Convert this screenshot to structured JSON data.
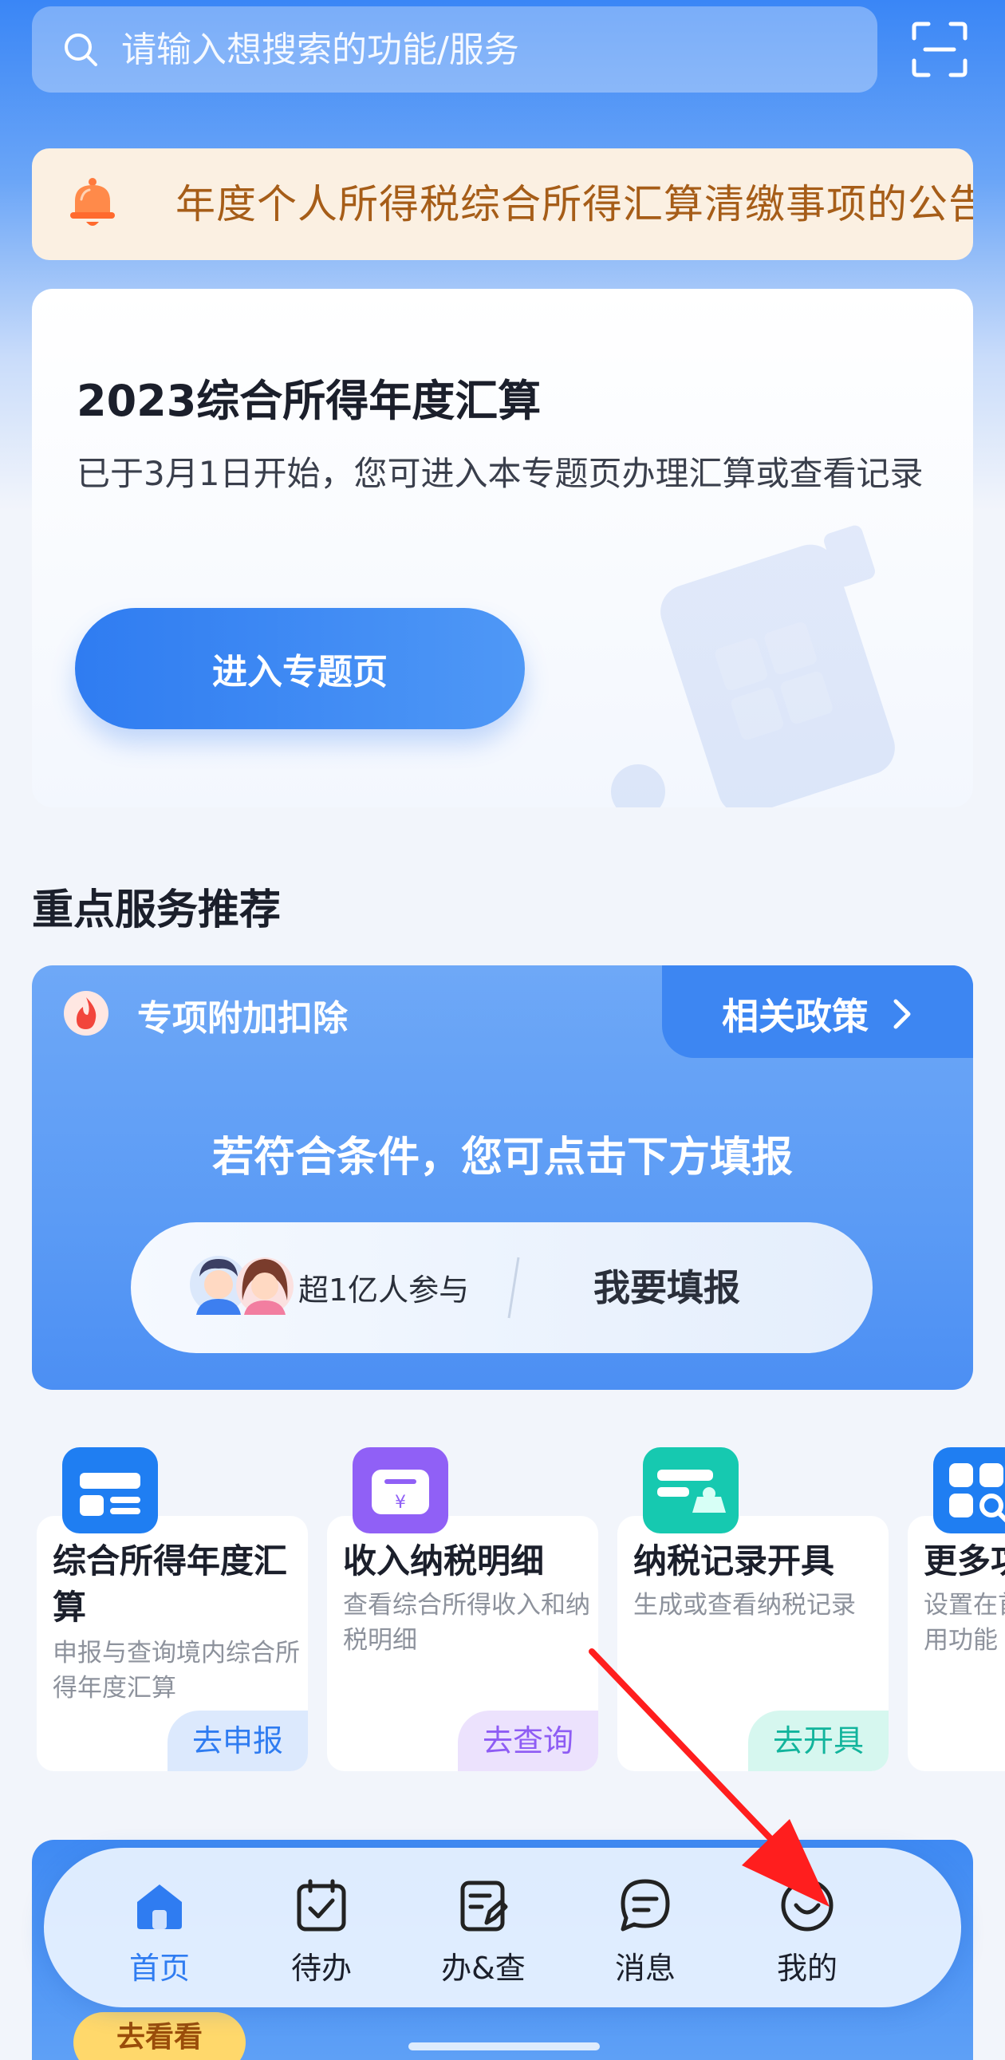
{
  "search": {
    "placeholder": "请输入想搜索的功能/服务"
  },
  "notice": {
    "text": "年度个人所得税综合所得汇算清缴事项的公告"
  },
  "hero": {
    "title": "2023综合所得年度汇算",
    "description": "已于3月1日开始，您可进入本专题页办理汇算或查看记录",
    "button_label": "进入专题页"
  },
  "section": {
    "title": "重点服务推荐"
  },
  "deduction": {
    "tab_label": "专项附加扣除",
    "policy_label": "相关政策",
    "tip": "若符合条件，您可点击下方填报",
    "participants": "超1亿人参与",
    "fill_label": "我要填报"
  },
  "services": [
    {
      "name": "综合所得年度汇算",
      "desc": "申报与查询境内综合所得年度汇算",
      "action": "去申报",
      "icon": "tax-return-icon",
      "color": "#1f7ef2"
    },
    {
      "name": "收入纳税明细",
      "desc": "查看综合所得收入和纳税明细",
      "action": "去查询",
      "icon": "income-detail-icon",
      "color": "#8e5cf4"
    },
    {
      "name": "纳税记录开具",
      "desc": "生成或查看纳税记录",
      "action": "去开具",
      "icon": "tax-record-icon",
      "color": "#16c9b0"
    },
    {
      "name": "更多功能",
      "desc": "设置在首页常用功能",
      "action": "",
      "icon": "more-apps-icon",
      "color": "#1f7ef2"
    }
  ],
  "banner": {
    "button_label": "去看看"
  },
  "nav": {
    "items": [
      {
        "label": "首页",
        "icon": "home-icon",
        "active": true
      },
      {
        "label": "待办",
        "icon": "todo-icon",
        "active": false
      },
      {
        "label": "办&查",
        "icon": "handle-query-icon",
        "active": false
      },
      {
        "label": "消息",
        "icon": "message-icon",
        "active": false
      },
      {
        "label": "我的",
        "icon": "profile-icon",
        "active": false
      }
    ]
  },
  "colors": {
    "primary": "#2f7cf1",
    "notice_text": "#a65d18",
    "annotation_arrow": "#ff1e1e"
  }
}
